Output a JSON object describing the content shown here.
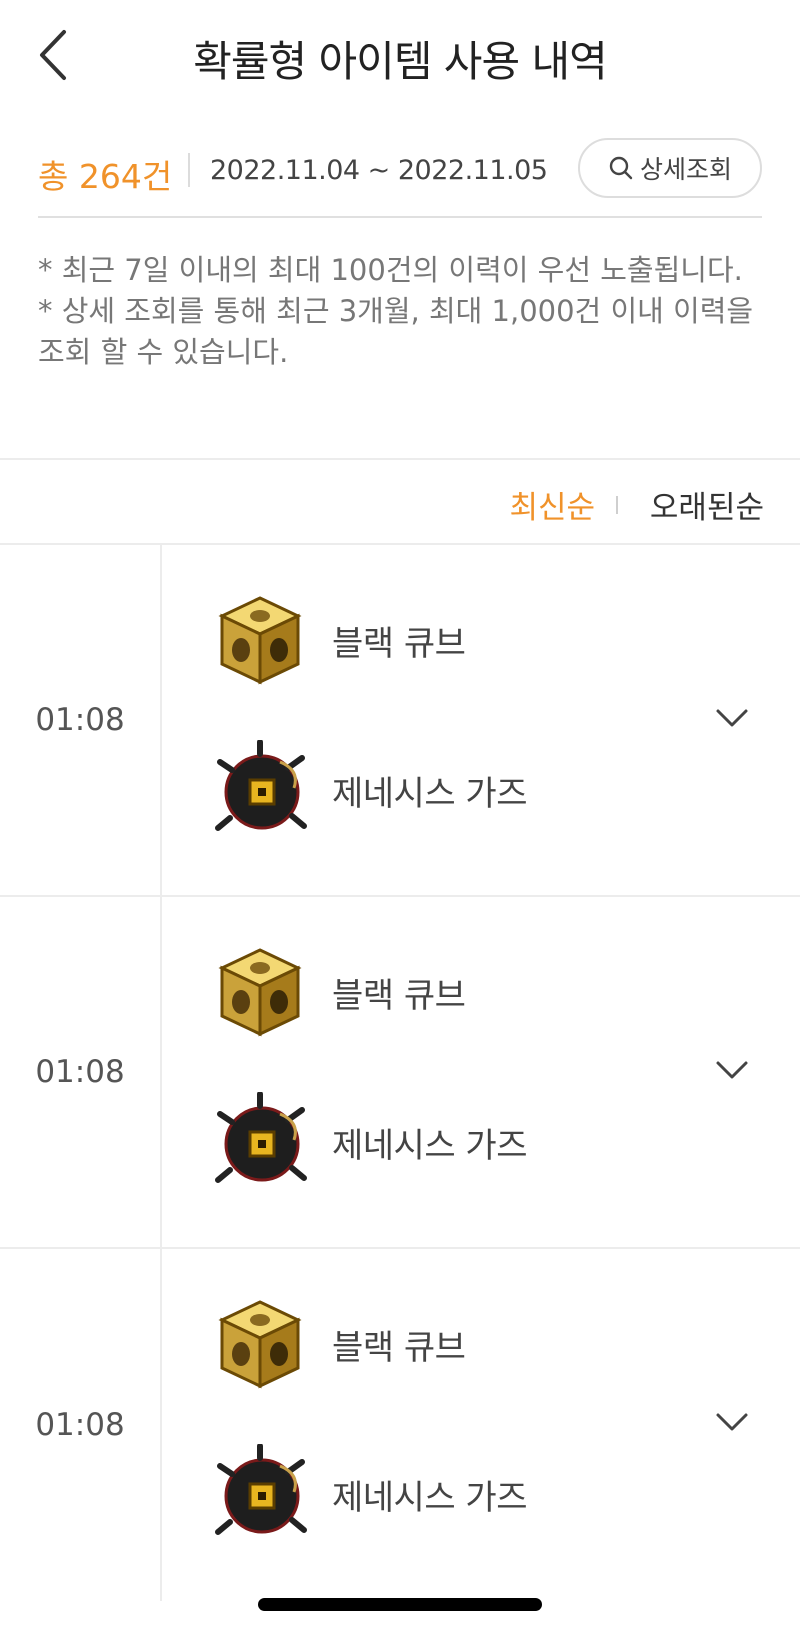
{
  "header": {
    "title": "확률형 아이템 사용 내역"
  },
  "summary": {
    "total": "총 264건",
    "date_range": "2022.11.04 ~ 2022.11.05",
    "detail_button": "상세조회"
  },
  "notice": {
    "line1": "* 최근 7일 이내의 최대 100건의 이력이 우선 노출됩니다.",
    "line2": "* 상세 조회를 통해 최근 3개월, 최대 1,000건 이내 이력을 조회 할 수 있습니다."
  },
  "sort": {
    "latest": "최신순",
    "oldest": "오래된순",
    "active": "latest"
  },
  "records": [
    {
      "time": "01:08",
      "items": [
        {
          "name": "블랙 큐브",
          "icon": "black-cube-icon"
        },
        {
          "name": "제네시스 가즈",
          "icon": "genesis-gaze-icon"
        }
      ]
    },
    {
      "time": "01:08",
      "items": [
        {
          "name": "블랙 큐브",
          "icon": "black-cube-icon"
        },
        {
          "name": "제네시스 가즈",
          "icon": "genesis-gaze-icon"
        }
      ]
    },
    {
      "time": "01:08",
      "items": [
        {
          "name": "블랙 큐브",
          "icon": "black-cube-icon"
        },
        {
          "name": "제네시스 가즈",
          "icon": "genesis-gaze-icon"
        }
      ]
    }
  ],
  "colors": {
    "accent": "#f0922a",
    "divider": "#ececec",
    "text": "#3a3a3a"
  }
}
